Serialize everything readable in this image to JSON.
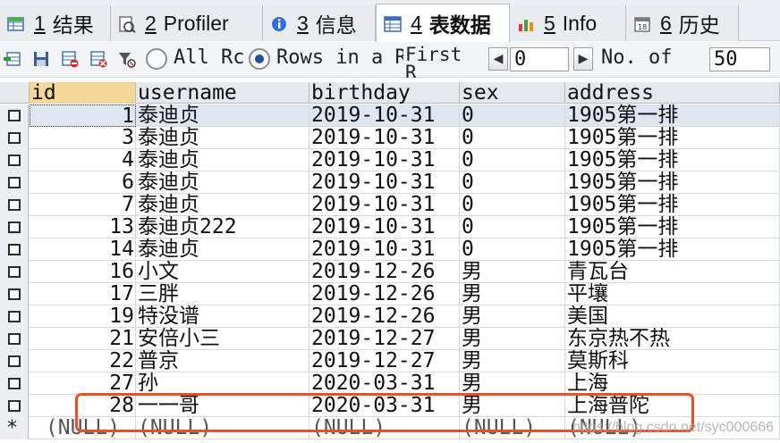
{
  "tabs": [
    {
      "num": "1",
      "label": "结果",
      "icon": "table-icon",
      "active": false
    },
    {
      "num": "2",
      "label": "Profiler",
      "icon": "profiler-icon",
      "active": false
    },
    {
      "num": "3",
      "label": "信息",
      "icon": "info-icon",
      "active": false
    },
    {
      "num": "4",
      "label": "表数据",
      "icon": "table-data-icon",
      "active": true
    },
    {
      "num": "5",
      "label": "Info",
      "icon": "chart-icon",
      "active": false
    },
    {
      "num": "6",
      "label": "历史",
      "icon": "history-icon",
      "active": false
    }
  ],
  "toolbar": {
    "icons": [
      "insert-row-icon",
      "save-icon",
      "delete-row-icon",
      "delete-rows-icon",
      "filter-icon"
    ],
    "radio_all_label": "All Rc",
    "radio_range_label": "Rows in a R",
    "radio_selected": "range",
    "first_label": "First",
    "first_sub": "R",
    "first_value": "0",
    "no_of_label": "No. of",
    "no_of_value": "50"
  },
  "grid": {
    "columns": [
      "id",
      "username",
      "birthday",
      "sex",
      "address"
    ],
    "rows": [
      {
        "id": "1",
        "username": "泰迪贞",
        "birthday": "2019-10-31",
        "sex": "0",
        "address": "1905第一排"
      },
      {
        "id": "3",
        "username": "泰迪贞",
        "birthday": "2019-10-31",
        "sex": "0",
        "address": "1905第一排"
      },
      {
        "id": "4",
        "username": "泰迪贞",
        "birthday": "2019-10-31",
        "sex": "0",
        "address": "1905第一排"
      },
      {
        "id": "6",
        "username": "泰迪贞",
        "birthday": "2019-10-31",
        "sex": "0",
        "address": "1905第一排"
      },
      {
        "id": "7",
        "username": "泰迪贞",
        "birthday": "2019-10-31",
        "sex": "0",
        "address": "1905第一排"
      },
      {
        "id": "13",
        "username": "泰迪贞222",
        "birthday": "2019-10-31",
        "sex": "0",
        "address": "1905第一排"
      },
      {
        "id": "14",
        "username": "泰迪贞",
        "birthday": "2019-10-31",
        "sex": "0",
        "address": "1905第一排"
      },
      {
        "id": "16",
        "username": "小文",
        "birthday": "2019-12-26",
        "sex": "男",
        "address": "青瓦台"
      },
      {
        "id": "17",
        "username": "三胖",
        "birthday": "2019-12-26",
        "sex": "男",
        "address": "平壤"
      },
      {
        "id": "19",
        "username": "特没谱",
        "birthday": "2019-12-26",
        "sex": "男",
        "address": "美国"
      },
      {
        "id": "21",
        "username": "安倍小三",
        "birthday": "2019-12-27",
        "sex": "男",
        "address": "东京热不热"
      },
      {
        "id": "22",
        "username": "普京",
        "birthday": "2019-12-27",
        "sex": "男",
        "address": "莫斯科"
      },
      {
        "id": "27",
        "username": "孙",
        "birthday": "2020-03-31",
        "sex": "男",
        "address": "上海"
      },
      {
        "id": "28",
        "username": "一一哥",
        "birthday": "2020-03-31",
        "sex": "男",
        "address": "上海普陀"
      }
    ],
    "new_row": {
      "id": "(NULL)",
      "username": "(NULL)",
      "birthday": "(NULL)",
      "sex": "(NULL)",
      "address": "(NULL)"
    },
    "new_row_marker": "*"
  },
  "watermark": "https://blog.csdn.net/syc000666",
  "colors": {
    "highlight": "#e8502a",
    "active_header": "#f3d89a",
    "selected_row": "#dfe6f3"
  }
}
